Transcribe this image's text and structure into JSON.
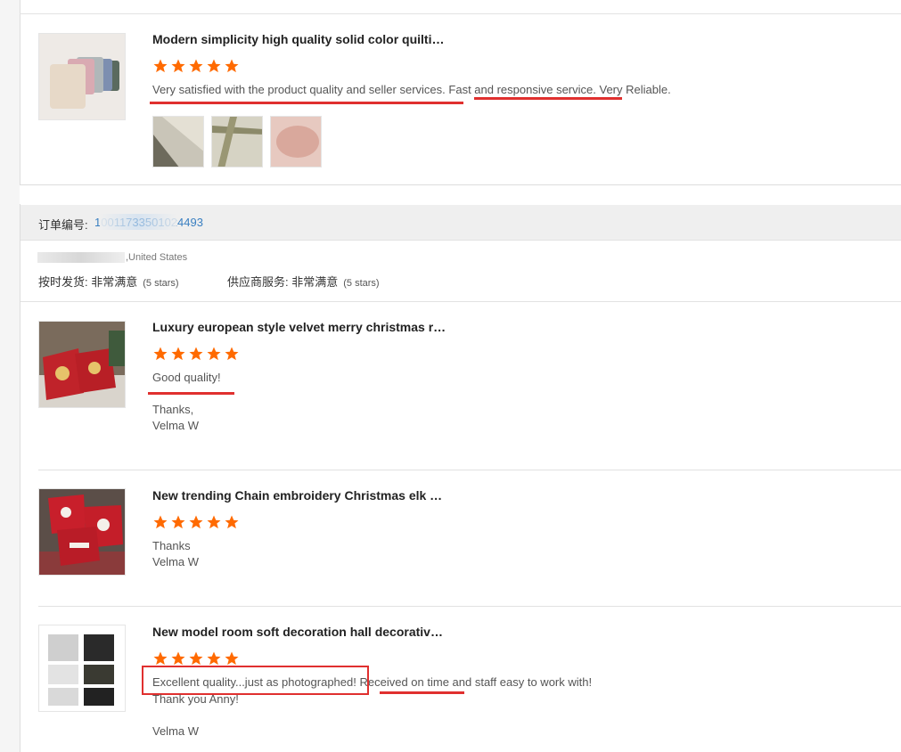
{
  "colors": {
    "star": "#ff6a00",
    "link": "#3a7fc1",
    "annotation": "#e0302f"
  },
  "review1": {
    "title": "Modern simplicity high quality solid color quilti…",
    "stars": 5,
    "text_a": "Very satisfied with the product quality and seller services.",
    "text_b": "Fast and responsive service.",
    "text_c": "Very Reliable."
  },
  "order": {
    "label": "订单编号:",
    "number": "10011733501024493",
    "location": ",United States",
    "shipping_label": "按时发货: 非常满意",
    "shipping_stars": "(5 stars)",
    "supplier_label": "供应商服务: 非常满意",
    "supplier_stars": "(5 stars)"
  },
  "review2": {
    "title": "Luxury european style velvet merry christmas r…",
    "stars": 5,
    "text": "Good quality!",
    "sig_line1": "Thanks,",
    "sig_line2": "Velma W"
  },
  "review3": {
    "title": "New trending Chain embroidery Christmas elk …",
    "stars": 5,
    "sig_line1": "Thanks",
    "sig_line2": "Velma W"
  },
  "review4": {
    "title": "New model room soft decoration hall decorativ…",
    "stars": 5,
    "text_a": "Excellent quality...just as photographed!",
    "text_b": "Received on time and staff easy to work with!",
    "sig_line1": "Thank you Anny!",
    "sig_line2": "Velma W"
  }
}
